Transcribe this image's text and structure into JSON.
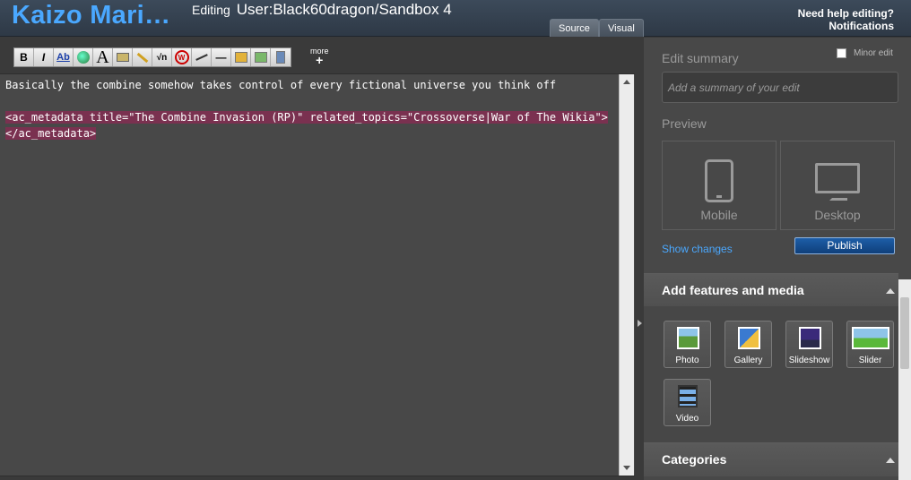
{
  "header": {
    "wiki_name": "Kaizo Mari…",
    "editing_prefix": "Editing",
    "page_name": "User:Black60dragon/Sandbox 4",
    "tabs": [
      {
        "label": "Source"
      },
      {
        "label": "Visual"
      }
    ],
    "help_label": "Need help editing?",
    "notifications_label": "Notifications"
  },
  "toolbar": {
    "buttons": [
      "B",
      "I",
      "Ab",
      "",
      "A",
      "",
      "",
      "√n",
      "W",
      "",
      "—",
      "",
      "",
      ""
    ],
    "more_label": "more",
    "more_plus": "+"
  },
  "editor": {
    "lines": [
      "Basically the combine somehow takes control of every fictional universe you think off",
      "",
      "<ac_metadata title=\"The Combine Invasion (RP)\" related_topics=\"Crossoverse|War of The Wikia\">",
      "</ac_metadata>"
    ]
  },
  "rail": {
    "minor_edit_label": "Minor edit",
    "edit_summary_label": "Edit summary",
    "edit_summary_placeholder": "Add a summary of your edit",
    "preview_label": "Preview",
    "mobile_label": "Mobile",
    "desktop_label": "Desktop",
    "show_changes_label": "Show changes",
    "publish_label": "Publish",
    "add_features_label": "Add features and media",
    "features": [
      {
        "label": "Photo"
      },
      {
        "label": "Gallery"
      },
      {
        "label": "Slideshow"
      },
      {
        "label": "Slider"
      },
      {
        "label": "Video"
      }
    ],
    "categories_label": "Categories"
  }
}
